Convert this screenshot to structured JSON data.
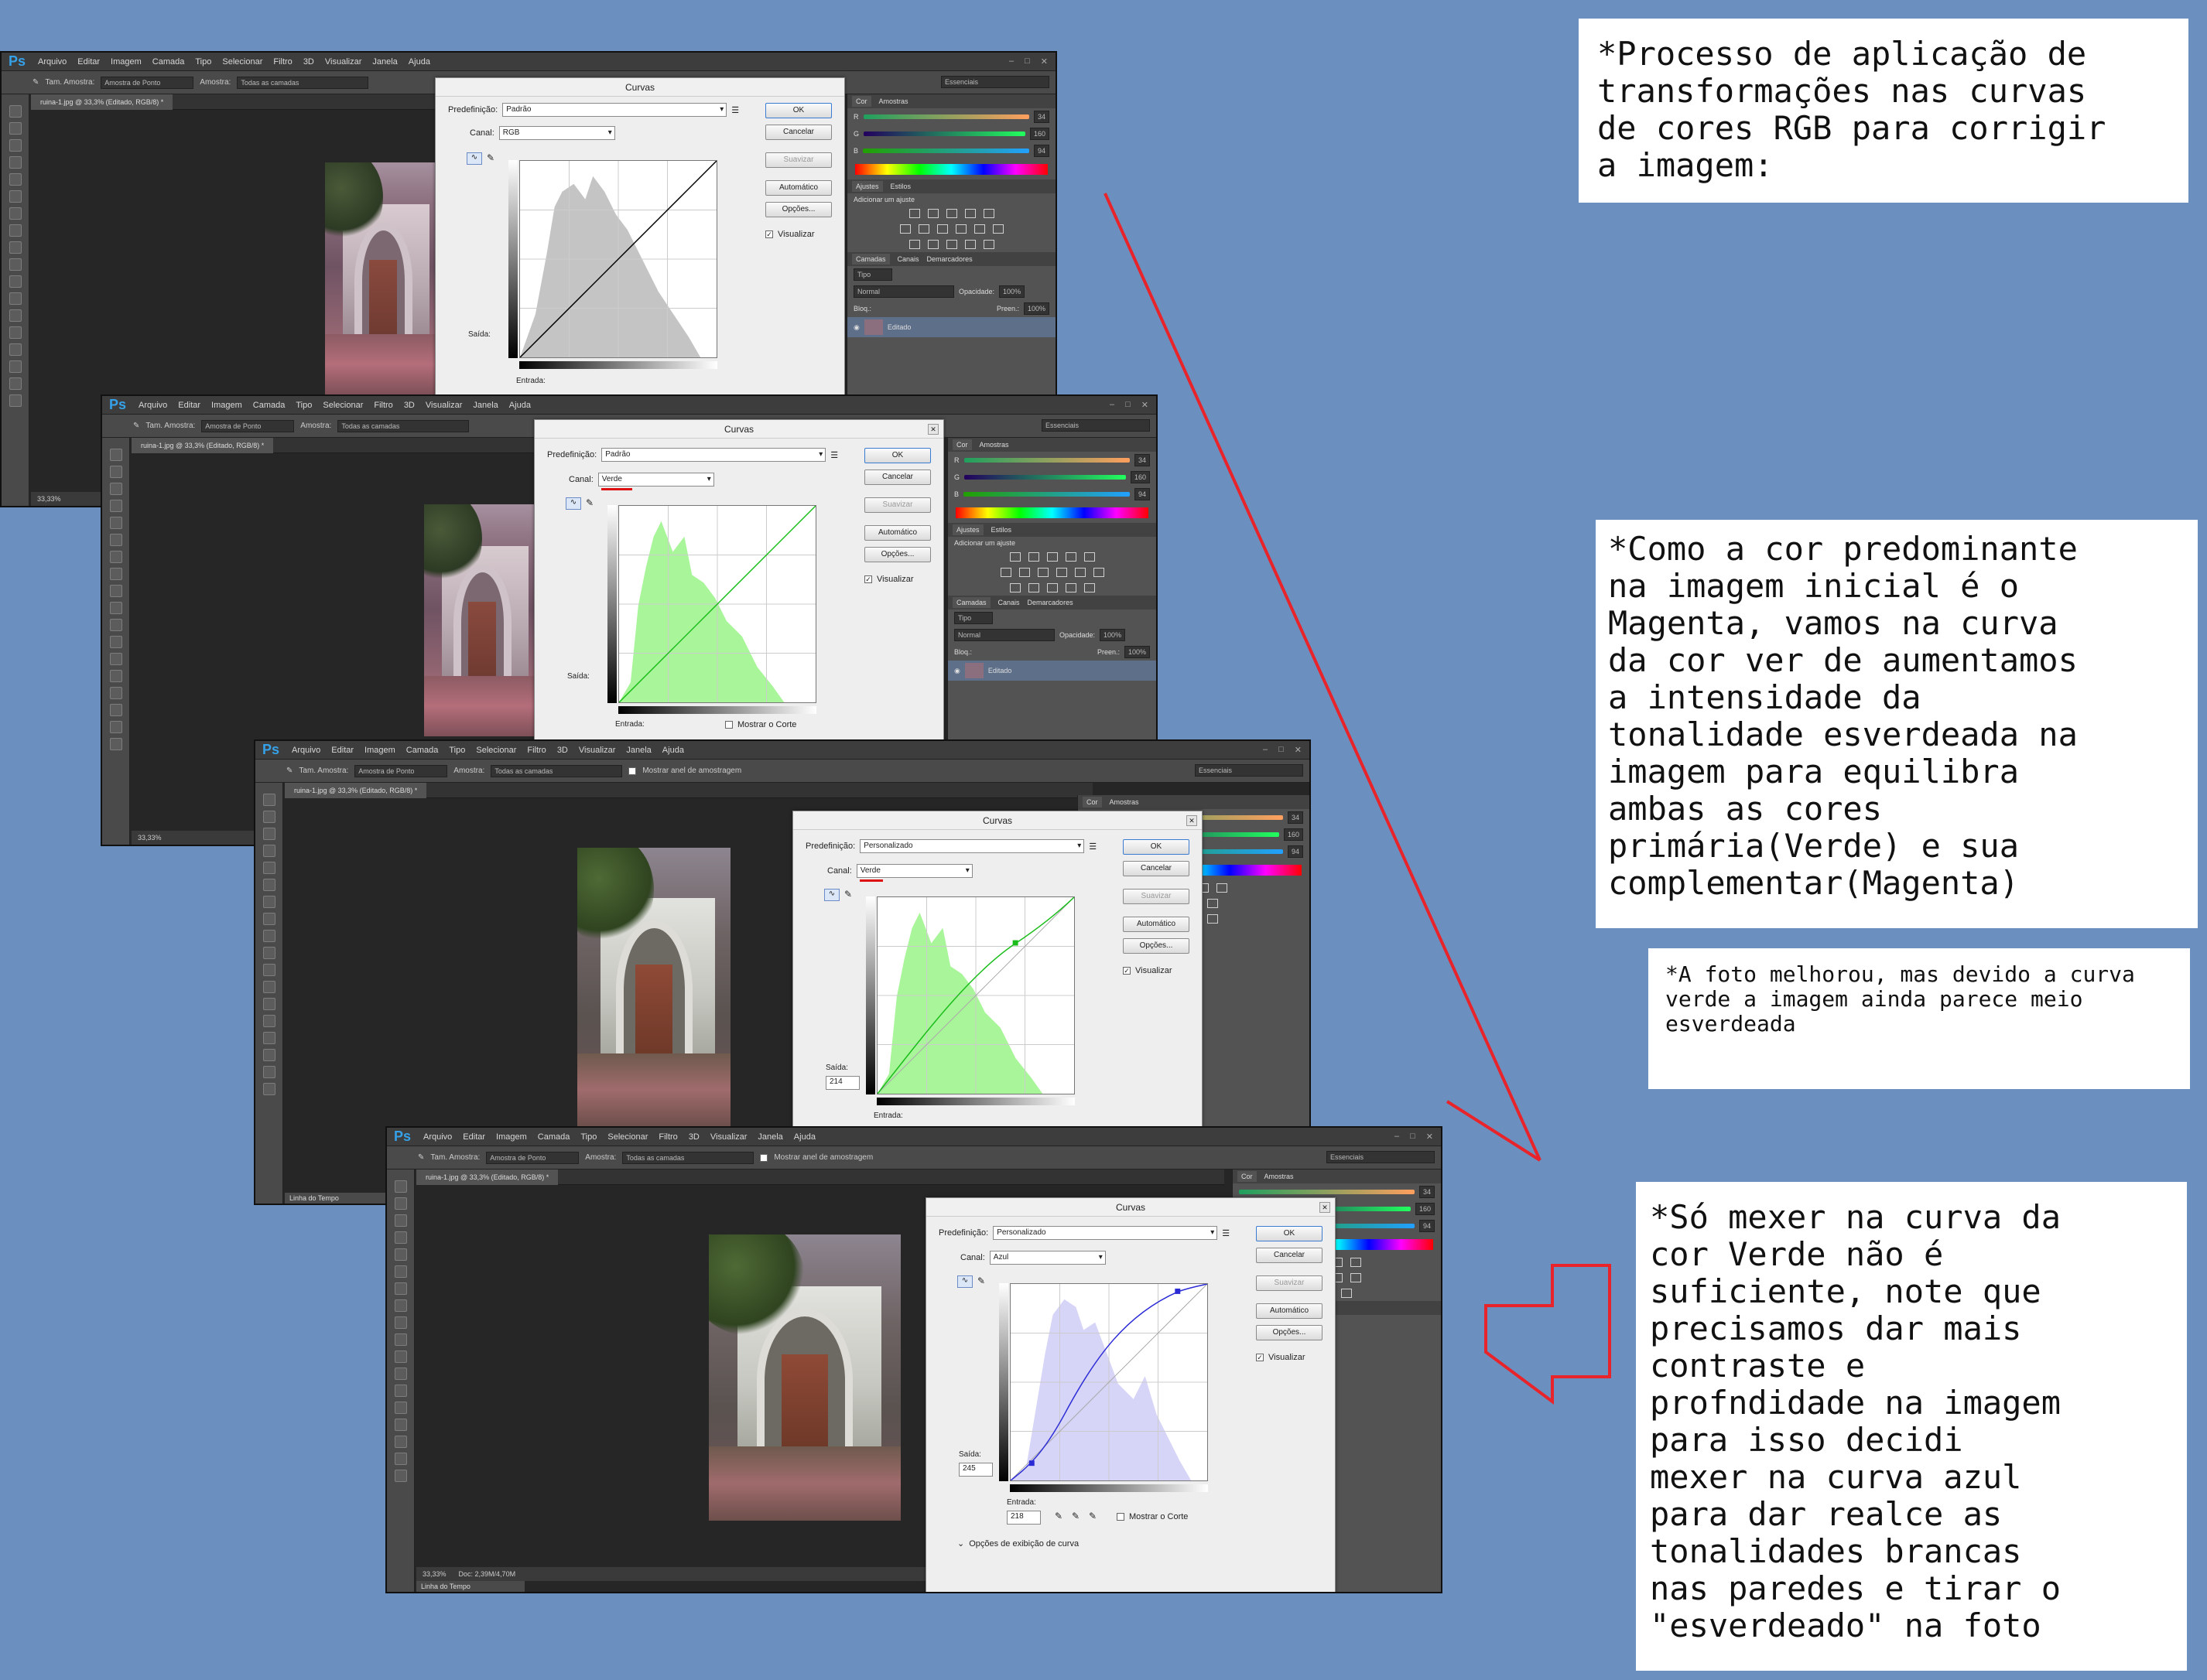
{
  "ps": {
    "logo": "Ps",
    "menu": [
      "Arquivo",
      "Editar",
      "Imagem",
      "Camada",
      "Tipo",
      "Selecionar",
      "Filtro",
      "3D",
      "Visualizar",
      "Janela",
      "Ajuda"
    ],
    "options": {
      "size_label": "Tam. Amostra:",
      "size_value": "Amostra de Ponto",
      "sample_label": "Amostra:",
      "sample_value": "Todas as camadas",
      "ring_label": "Mostrar anel de amostragem",
      "workspace": "Essenciais"
    },
    "doc_tab": "ruina-1.jpg @ 33,3% (Editado, RGB/8) *",
    "zoom": "33,33%",
    "doc_size": "Doc: 2,39M/4,70M",
    "timeline": "Linha do Tempo",
    "panels": {
      "color_tab": "Cor",
      "swatches_tab": "Amostras",
      "r": "R",
      "g": "G",
      "b": "B",
      "r_val": "34",
      "g_val": "160",
      "b_val": "94",
      "adjust_tab": "Ajustes",
      "styles_tab": "Estilos",
      "add_adjust": "Adicionar um ajuste",
      "layers_tab": "Camadas",
      "channels_tab": "Canais",
      "paths_tab": "Demarcadores",
      "kind": "Tipo",
      "blend": "Normal",
      "opacity_label": "Opacidade:",
      "opacity_val": "100%",
      "lock_label": "Bloq.:",
      "fill_label": "Preen.:",
      "fill_val": "100%",
      "layer_name": "Editado"
    }
  },
  "curves": {
    "title": "Curvas",
    "preset_label": "Predefinição:",
    "channel_label": "Canal:",
    "output_label": "Saída:",
    "input_label": "Entrada:",
    "ok": "OK",
    "cancel": "Cancelar",
    "smooth": "Suavizar",
    "auto": "Automático",
    "options": "Opções...",
    "preview": "Visualizar",
    "show_clip": "Mostrar o Corte",
    "display_options": "Opções de exibição de curva",
    "dialogs": [
      {
        "preset": "Padrão",
        "channel": "RGB",
        "output": "",
        "input": ""
      },
      {
        "preset": "Padrão",
        "channel": "Verde",
        "output": "",
        "input": ""
      },
      {
        "preset": "Personalizado",
        "channel": "Verde",
        "output": "214",
        "input": ""
      },
      {
        "preset": "Personalizado",
        "channel": "Azul",
        "output": "245",
        "input": "218"
      }
    ]
  },
  "notes": {
    "note1": "*Processo de aplicação de\ntransformações nas curvas\nde cores RGB para corrigir\na imagem:",
    "note2": "*Como a cor predominante\nna imagem inicial é o\nMagenta, vamos na curva\nda cor ver de aumentamos\na intensidade da\ntonalidade esverdeada na\nimagem para equilibra\nambas as cores\nprimária(Verde) e sua\ncomplementar(Magenta)",
    "note3": "*A foto melhorou, mas devido a curva\nverde a imagem ainda parece meio\nesverdeada",
    "note4": "*Só mexer na curva da\ncor Verde não é\nsuficiente, note que\nprecisamos dar mais\ncontraste e\nprofndidade na imagem\npara isso decidi\nmexer na curva azul\npara dar realce as\ntonalidades brancas\nnas paredes e tirar o\n\"esverdeado\" na foto"
  },
  "colors": {
    "background": "#6b90bf",
    "arrow": "#e8232a",
    "green_hist": "#a9f59a",
    "blue_hist": "#d6d4f7",
    "gray_hist": "#c4c4c4"
  }
}
